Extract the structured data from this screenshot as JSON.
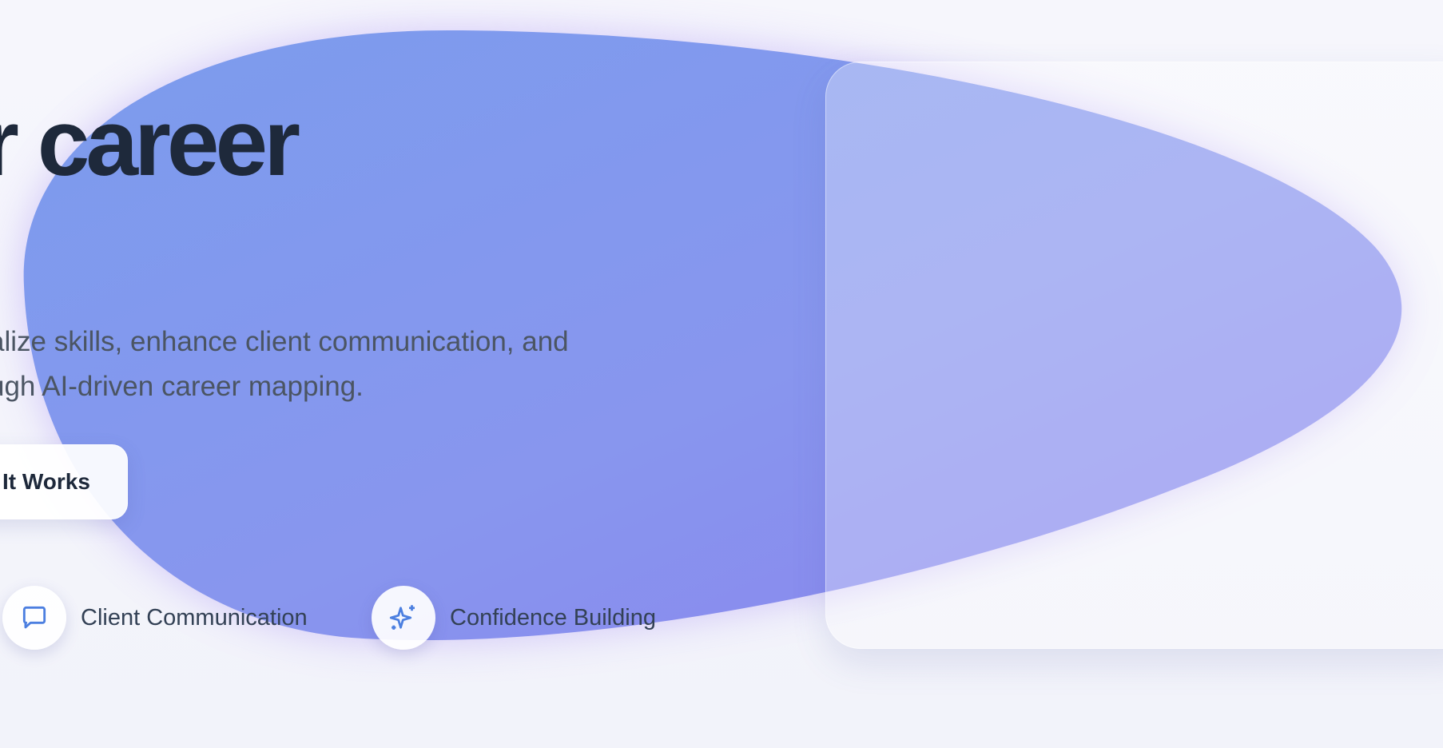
{
  "hero": {
    "headline": "r career",
    "subtitle_line1": "alize skills, enhance client communication, and",
    "subtitle_line2": "ugh AI-driven career mapping.",
    "cta_secondary_label": "It Works"
  },
  "features": [
    {
      "label": "Client Communication",
      "icon": "chat-bubble-icon"
    },
    {
      "label": "Confidence Building",
      "icon": "sparkle-icon"
    }
  ],
  "colors": {
    "background": "#f3f4fb",
    "blob_start": "#7b9ced",
    "blob_end": "#8a84ee",
    "headline": "#1e293b",
    "body_text": "#4b5563",
    "icon_accent": "#4c7fe0"
  }
}
